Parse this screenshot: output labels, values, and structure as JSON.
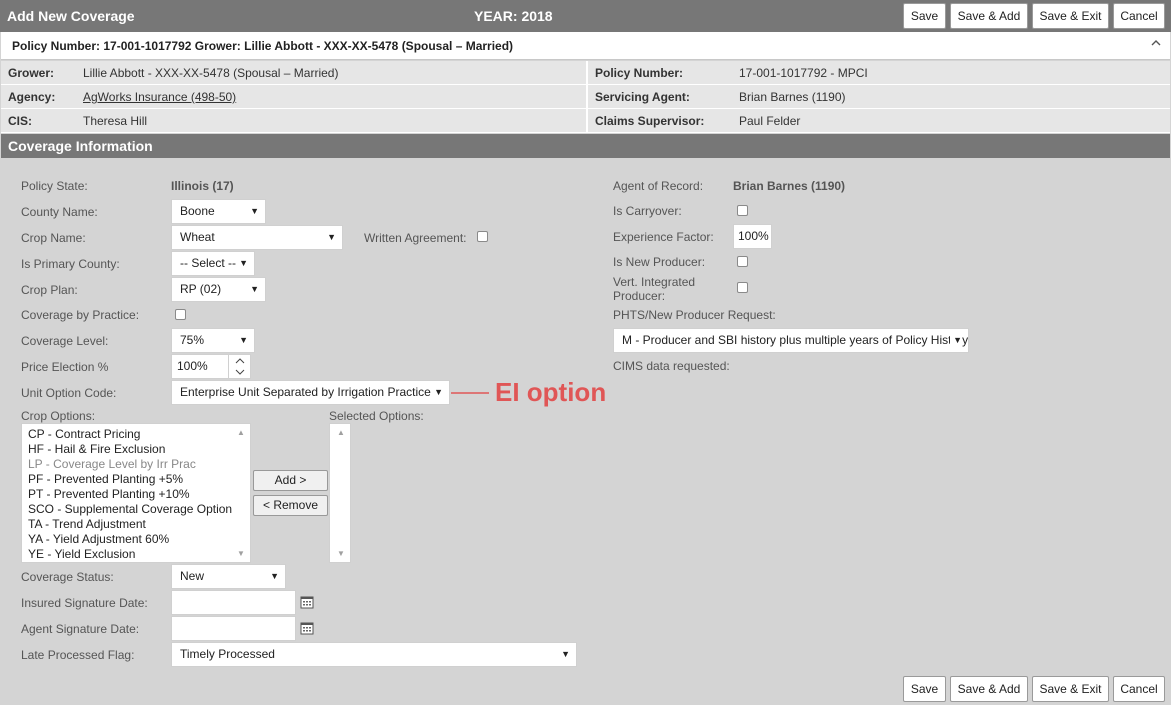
{
  "window": {
    "title": "Add New Coverage",
    "year": "YEAR: 2018"
  },
  "toolbar": {
    "save": "Save",
    "save_add": "Save & Add",
    "save_exit": "Save & Exit",
    "cancel": "Cancel"
  },
  "policy_header": {
    "text": "Policy Number: 17-001-1017792 Grower: Lillie Abbott - XXX-XX-5478 (Spousal – Married)",
    "collapse_icon": "chevron-up-icon"
  },
  "info": {
    "grower_label": "Grower:",
    "grower_value": "Lillie Abbott - XXX-XX-5478 (Spousal – Married)",
    "policy_number_label": "Policy Number:",
    "policy_number_value": "17-001-1017792 - MPCI",
    "agency_label": "Agency:",
    "agency_value": "AgWorks Insurance (498-50)",
    "servicing_agent_label": "Servicing Agent:",
    "servicing_agent_value": "Brian Barnes (1190)",
    "cis_label": "CIS:",
    "cis_value": "Theresa Hill",
    "claims_supervisor_label": "Claims Supervisor:",
    "claims_supervisor_value": "Paul Felder"
  },
  "coverage": {
    "section_title": "Coverage Information",
    "policy_state_label": "Policy State:",
    "policy_state_value": "Illinois (17)",
    "county_name_label": "County Name:",
    "county_name_value": "Boone",
    "crop_name_label": "Crop Name:",
    "crop_name_value": "Wheat",
    "written_agreement_label": "Written Agreement:",
    "is_primary_county_label": "Is Primary County:",
    "is_primary_county_value": "-- Select --",
    "crop_plan_label": "Crop Plan:",
    "crop_plan_value": "RP (02)",
    "coverage_by_practice_label": "Coverage by Practice:",
    "coverage_level_label": "Coverage Level:",
    "coverage_level_value": "75%",
    "price_election_label": "Price Election %",
    "price_election_value": "100%",
    "unit_option_code_label": "Unit Option Code:",
    "unit_option_code_value": "Enterprise Unit Separated by Irrigation Practice",
    "crop_options_label": "Crop Options:",
    "selected_options_label": "Selected Options:",
    "crop_options": [
      {
        "label": "CP - Contract Pricing",
        "disabled": false
      },
      {
        "label": "HF - Hail & Fire Exclusion",
        "disabled": false
      },
      {
        "label": "LP - Coverage Level by Irr Prac",
        "disabled": true
      },
      {
        "label": "PF - Prevented Planting +5%",
        "disabled": false
      },
      {
        "label": "PT - Prevented Planting +10%",
        "disabled": false
      },
      {
        "label": "SCO - Supplemental Coverage Option",
        "disabled": false
      },
      {
        "label": "TA - Trend Adjustment",
        "disabled": false
      },
      {
        "label": "YA - Yield Adjustment 60%",
        "disabled": false
      },
      {
        "label": "YE - Yield Exclusion",
        "disabled": false
      }
    ],
    "add_label": "Add >",
    "remove_label": "< Remove",
    "coverage_status_label": "Coverage Status:",
    "coverage_status_value": "New",
    "insured_signature_date_label": "Insured Signature Date:",
    "insured_signature_date_value": "",
    "agent_signature_date_label": "Agent Signature Date:",
    "agent_signature_date_value": "",
    "late_processed_flag_label": "Late Processed Flag:",
    "late_processed_flag_value": "Timely Processed",
    "agent_of_record_label": "Agent of Record:",
    "agent_of_record_value": "Brian Barnes (1190)",
    "is_carryover_label": "Is Carryover:",
    "experience_factor_label": "Experience Factor:",
    "experience_factor_value": "100%",
    "is_new_producer_label": "Is New Producer:",
    "vert_integrated_label_line1": "Vert. Integrated",
    "vert_integrated_label_line2": "Producer:",
    "phts_label": "PHTS/New Producer Request:",
    "phts_value": "M - Producer and SBI history plus multiple years of Policy History",
    "cims_label": "CIMS data requested:"
  },
  "annotation": {
    "text": "EI option",
    "color": "#e05656"
  }
}
